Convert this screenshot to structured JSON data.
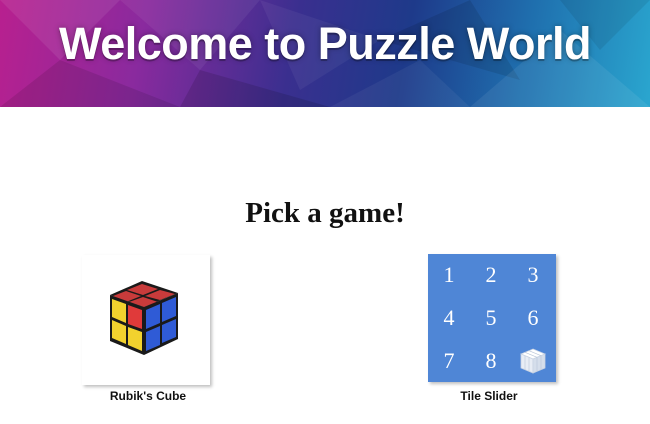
{
  "banner": {
    "title": "Welcome to Puzzle World"
  },
  "heading": "Pick a game!",
  "games": [
    {
      "name": "Rubik's Cube",
      "icon": "rubiks-cube-icon"
    },
    {
      "name": "Tile Slider",
      "icon": "tile-grid-icon",
      "tiles": [
        "1",
        "2",
        "3",
        "4",
        "5",
        "6",
        "7",
        "8"
      ]
    }
  ],
  "colors": {
    "banner_gradient": [
      "#b8208f",
      "#3a2f8f",
      "#2aa6cf"
    ],
    "tile_background": "#4f86d6"
  }
}
